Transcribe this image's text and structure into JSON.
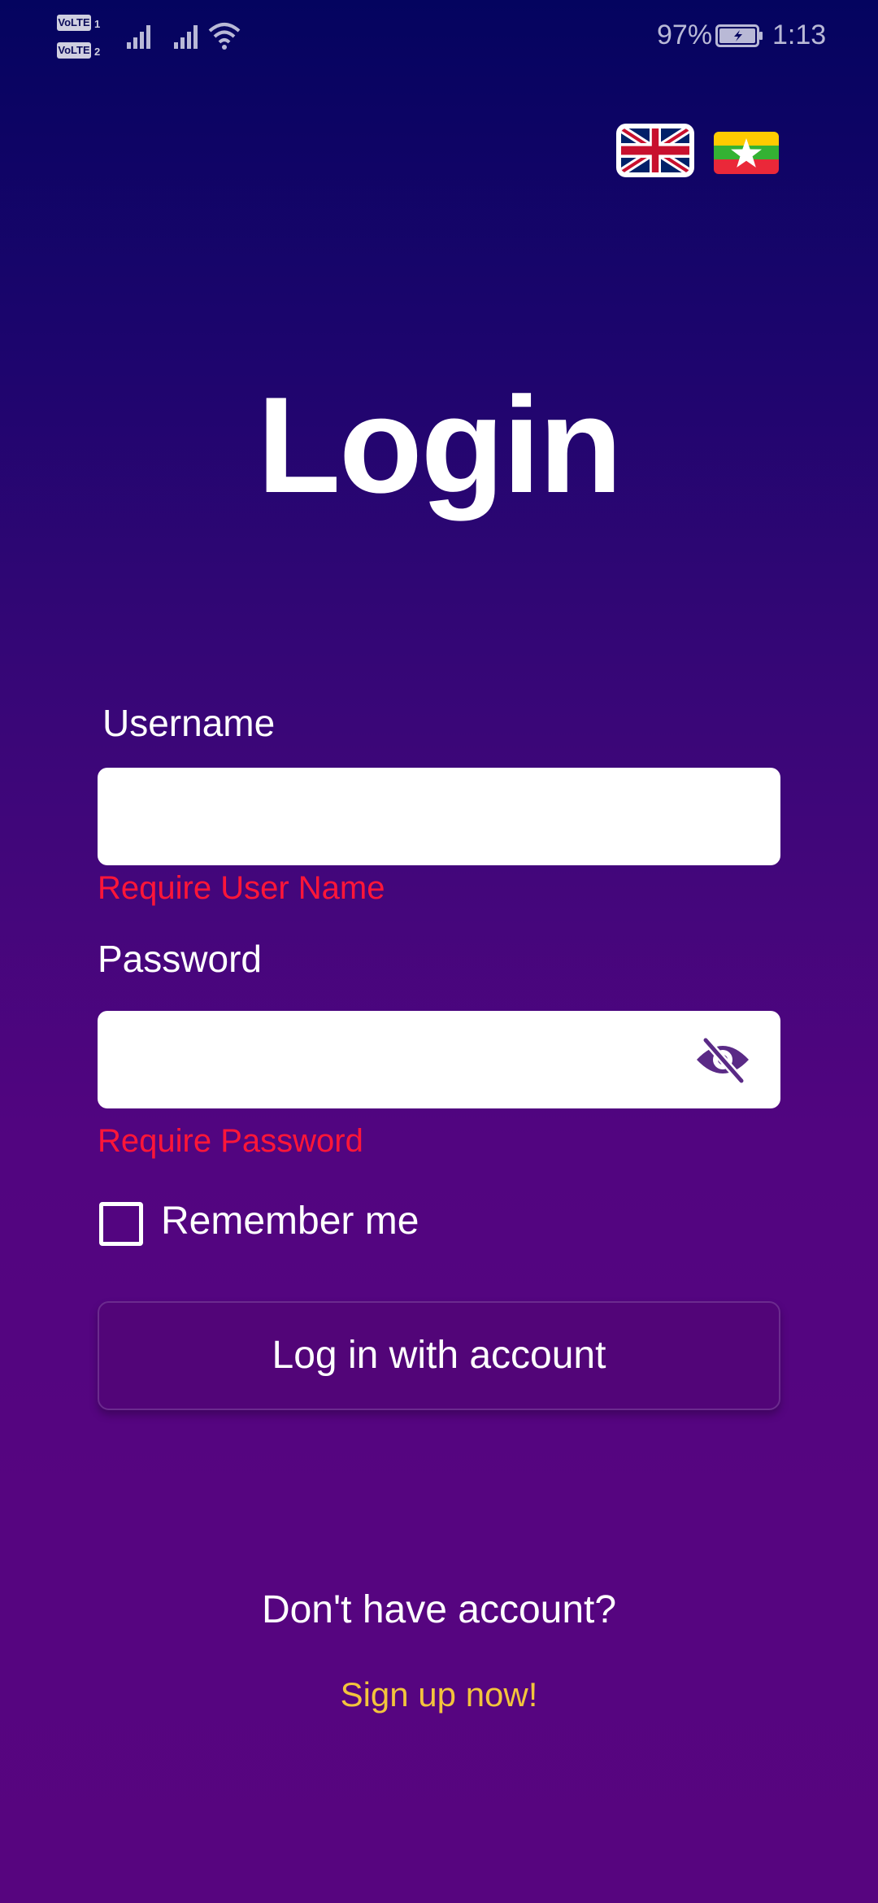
{
  "status_bar": {
    "sim1_badge": "VoLTE",
    "sim1_number": "1",
    "sim2_badge": "VoLTE",
    "sim2_number": "2",
    "battery_percent": "97%",
    "time": "1:13",
    "icons": [
      "signal-icon",
      "signal-icon",
      "wifi-icon",
      "battery-charging-icon"
    ]
  },
  "language": {
    "options": [
      "english-flag-icon",
      "myanmar-flag-icon"
    ]
  },
  "login": {
    "title": "Login",
    "username_label": "Username",
    "username_value": "",
    "username_error": "Require User Name",
    "password_label": "Password",
    "password_value": "",
    "password_error": "Require Password",
    "password_toggle_icon": "eye-off-icon",
    "remember_label": "Remember me",
    "remember_checked": false,
    "submit_label": "Log in with account"
  },
  "footer": {
    "prompt": "Don't have account?",
    "signup_label": "Sign up now!"
  },
  "colors": {
    "background_top": "#04045f",
    "background_bottom": "#57057f",
    "error": "#ff1638",
    "link": "#f3c43c",
    "button_bg": "#520578",
    "eye_icon": "#5a2a86"
  }
}
